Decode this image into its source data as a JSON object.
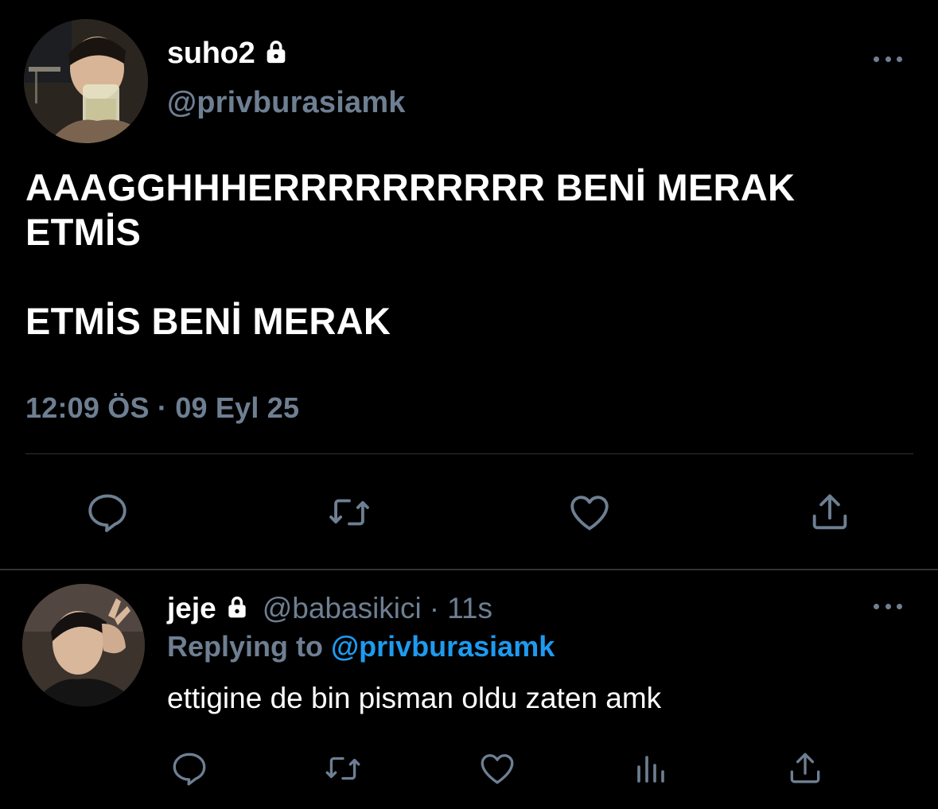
{
  "main_tweet": {
    "display_name": "suho2",
    "handle": "@privburasiamk",
    "text_lines": [
      "AAAGGHHHERRRRRRRRRR BENİ MERAK",
      "ETMİS",
      "",
      "ETMİS BENİ MERAK"
    ],
    "timestamp": "12:09 ÖS · 09 Eyl 25",
    "actions": [
      "reply-icon",
      "retweet-icon",
      "like-icon",
      "share-icon"
    ]
  },
  "reply_tweet": {
    "display_name": "jeje",
    "handle": "@babasikici",
    "separator": "·",
    "time_ago": "11s",
    "replying_prefix": "Replying to",
    "replying_to": "@privburasiamk",
    "text": "ettigine de bin pisman oldu zaten amk",
    "actions": [
      "reply-icon",
      "retweet-icon",
      "like-icon",
      "analytics-icon",
      "share-icon"
    ]
  },
  "colors": {
    "background": "#000000",
    "text_primary": "#ffffff",
    "text_secondary": "#6e7f92",
    "link": "#1d9bf0",
    "divider": "#2f3336"
  }
}
